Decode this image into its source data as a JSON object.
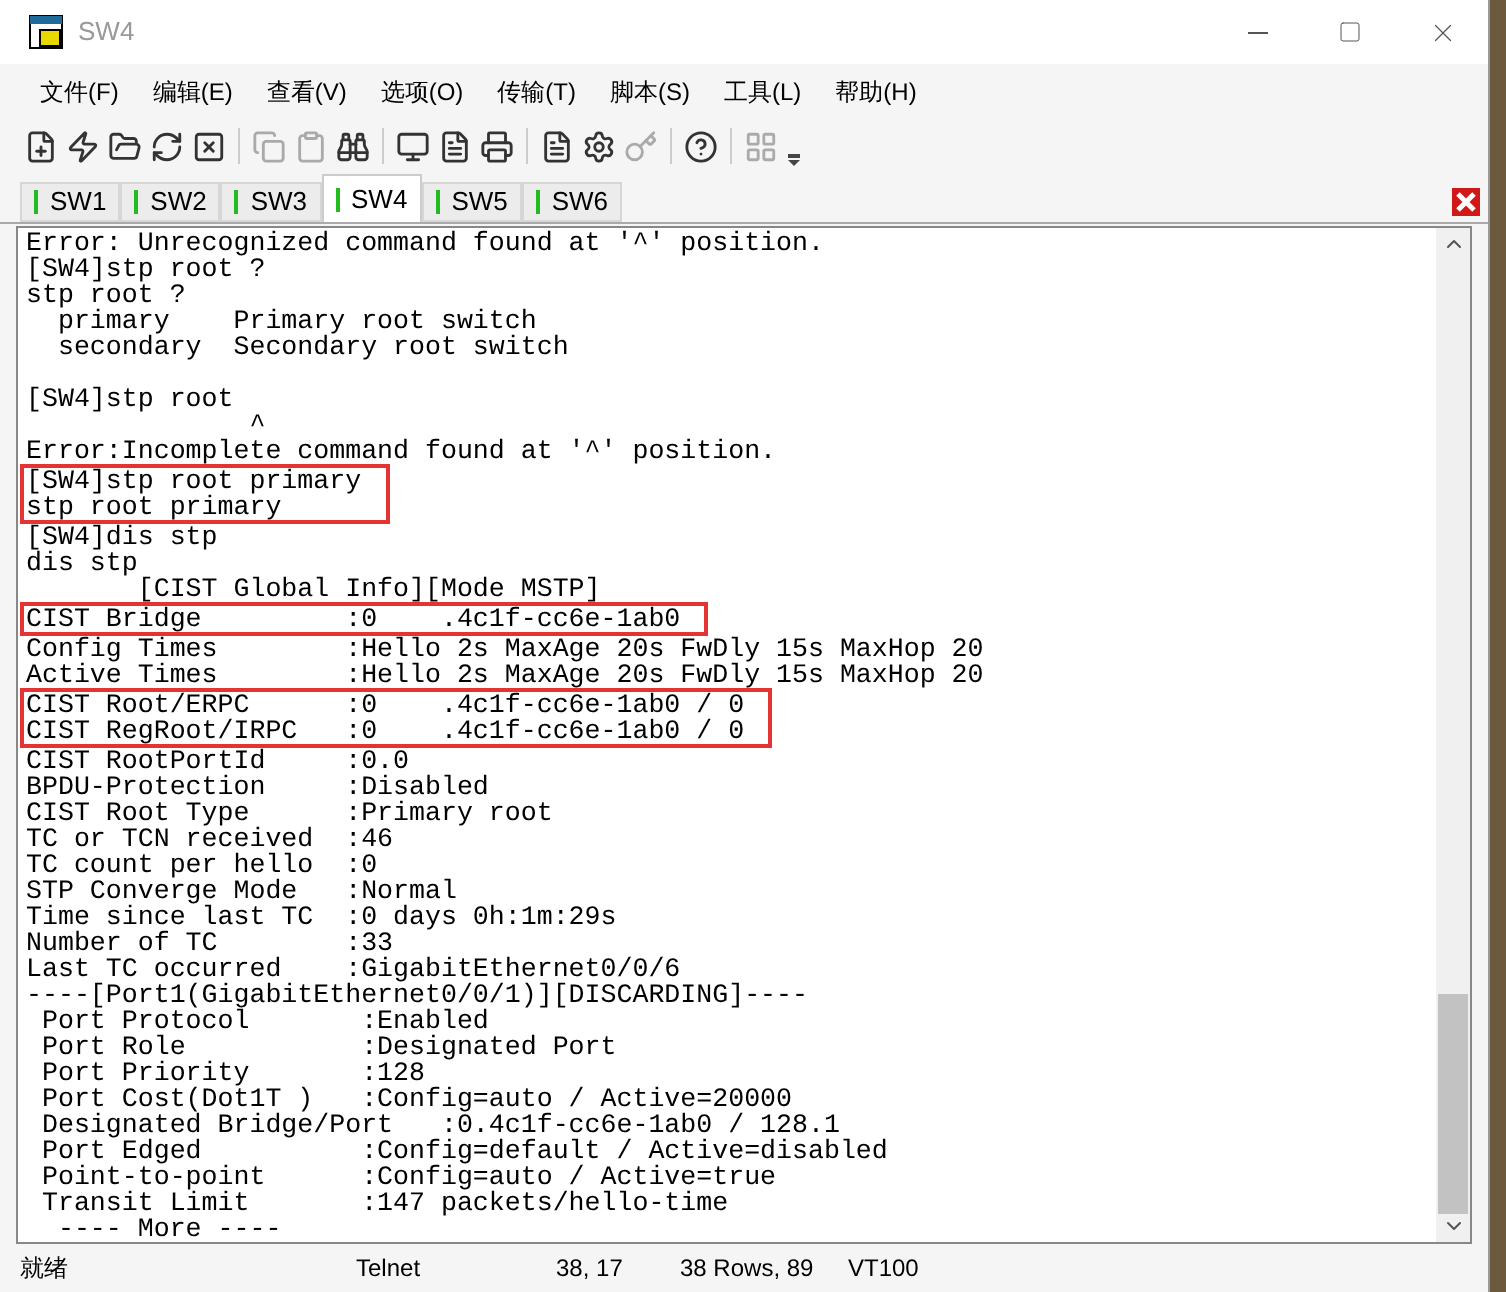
{
  "window": {
    "title": "SW4"
  },
  "menu": [
    "文件(F)",
    "编辑(E)",
    "查看(V)",
    "选项(O)",
    "传输(T)",
    "脚本(S)",
    "工具(L)",
    "帮助(H)"
  ],
  "tabs": [
    {
      "label": "SW1",
      "selected": false
    },
    {
      "label": "SW2",
      "selected": false
    },
    {
      "label": "SW3",
      "selected": false
    },
    {
      "label": "SW4",
      "selected": true
    },
    {
      "label": "SW5",
      "selected": false
    },
    {
      "label": "SW6",
      "selected": false
    }
  ],
  "terminal": {
    "lines": [
      {
        "text": "Error: Unrecognized command found at '^' position.",
        "highlighted": false
      },
      {
        "text": "[SW4]stp root ?",
        "highlighted": false
      },
      {
        "text": "stp root ?",
        "highlighted": false
      },
      {
        "text": "  primary    Primary root switch",
        "highlighted": false
      },
      {
        "text": "  secondary  Secondary root switch",
        "highlighted": false
      },
      {
        "highlighted": false
      },
      {
        "text": "[SW4]stp root",
        "highlighted": false
      },
      {
        "text": "              ^",
        "highlighted": false
      },
      {
        "text": "Error:Incomplete command found at '^' position.",
        "highlighted": false
      },
      {
        "text": "[SW4]stp root primary",
        "highlighted": true
      },
      {
        "text": "stp root primary",
        "highlighted": true
      },
      {
        "text": "[SW4]dis stp",
        "highlighted": false
      },
      {
        "text": "dis stp",
        "highlighted": false
      },
      {
        "text": "       [CIST Global Info][Mode MSTP]",
        "highlighted": false
      },
      {
        "text": "CIST Bridge         :0    .4c1f-cc6e-1ab0",
        "highlighted": true
      },
      {
        "text": "Config Times        :Hello 2s MaxAge 20s FwDly 15s MaxHop 20",
        "highlighted": false
      },
      {
        "text": "Active Times        :Hello 2s MaxAge 20s FwDly 15s MaxHop 20",
        "highlighted": false
      },
      {
        "text": "CIST Root/ERPC      :0    .4c1f-cc6e-1ab0 / 0",
        "highlighted": true
      },
      {
        "text": "CIST RegRoot/IRPC   :0    .4c1f-cc6e-1ab0 / 0",
        "highlighted": true
      },
      {
        "text": "CIST RootPortId     :0.0",
        "highlighted": false
      },
      {
        "text": "BPDU-Protection     :Disabled",
        "highlighted": false
      },
      {
        "text": "CIST Root Type      :Primary root",
        "highlighted": false
      },
      {
        "text": "TC or TCN received  :46",
        "highlighted": false
      },
      {
        "text": "TC count per hello  :0",
        "highlighted": false
      },
      {
        "text": "STP Converge Mode   :Normal",
        "highlighted": false
      },
      {
        "text": "Time since last TC  :0 days 0h:1m:29s",
        "highlighted": false
      },
      {
        "text": "Number of TC        :33",
        "highlighted": false
      },
      {
        "text": "Last TC occurred    :GigabitEthernet0/0/6",
        "highlighted": false
      },
      {
        "text": "----[Port1(GigabitEthernet0/0/1)][DISCARDING]----",
        "highlighted": false
      },
      {
        "text": " Port Protocol       :Enabled",
        "highlighted": false
      },
      {
        "text": " Port Role           :Designated Port",
        "highlighted": false
      },
      {
        "text": " Port Priority       :128",
        "highlighted": false
      },
      {
        "text": " Port Cost(Dot1T )   :Config=auto / Active=20000",
        "highlighted": false
      },
      {
        "text": " Designated Bridge/Port   :0.4c1f-cc6e-1ab0 / 128.1",
        "highlighted": false
      },
      {
        "text": " Port Edged          :Config=default / Active=disabled",
        "highlighted": false
      },
      {
        "text": " Point-to-point      :Config=auto / Active=true",
        "highlighted": false
      },
      {
        "text": " Transit Limit       :147 packets/hello-time",
        "highlighted": false
      },
      {
        "text": "  ---- More ----",
        "highlighted": false
      }
    ]
  },
  "status_bar": [
    "就绪",
    "Telnet",
    "38,  17",
    "38 Rows, 89",
    "VT100"
  ]
}
